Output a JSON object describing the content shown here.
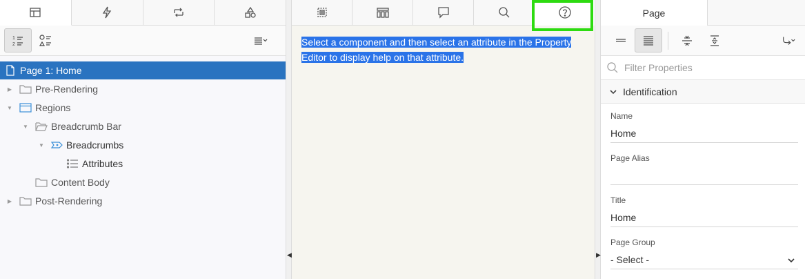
{
  "left": {
    "tabs": [
      {
        "icon": "rendering-tree-icon"
      },
      {
        "icon": "dynamic-actions-icon"
      },
      {
        "icon": "processing-icon"
      },
      {
        "icon": "shared-components-icon"
      }
    ],
    "toolbar": {
      "view_buttons": [
        {
          "icon": "numbered-list-icon",
          "pressed": true
        },
        {
          "icon": "grouped-list-icon",
          "pressed": false
        }
      ],
      "menu_icon": "menu-icon"
    },
    "tree": [
      {
        "label": "Page 1: Home",
        "icon": "page-icon",
        "toggle": "",
        "selected": true
      },
      {
        "label": "Pre-Rendering",
        "icon": "folder-icon",
        "toggle": "▶"
      },
      {
        "label": "Regions",
        "icon": "region-icon",
        "toggle": "▼"
      },
      {
        "label": "Breadcrumb Bar",
        "icon": "folder-open-icon",
        "toggle": "▼"
      },
      {
        "label": "Breadcrumbs",
        "icon": "breadcrumb-icon",
        "toggle": "▼"
      },
      {
        "label": "Attributes",
        "icon": "list-icon",
        "toggle": ""
      },
      {
        "label": "Content Body",
        "icon": "folder-icon",
        "toggle": ""
      },
      {
        "label": "Post-Rendering",
        "icon": "folder-icon",
        "toggle": "▶"
      }
    ]
  },
  "middle": {
    "tabs": [
      {
        "icon": "messages-icon"
      },
      {
        "icon": "page-search-icon"
      },
      {
        "icon": "comments-icon"
      },
      {
        "icon": "search-icon"
      },
      {
        "icon": "help-icon"
      }
    ],
    "help_text": "Select a component and then select an attribute in the Property Editor to display help on that attribute."
  },
  "right": {
    "tab_label": "Page",
    "toolbar": {
      "buttons": [
        "show-common-icon",
        "show-all-icon",
        "collapse-all-icon",
        "expand-all-icon",
        "go-to-group-icon"
      ]
    },
    "filter": {
      "placeholder": "Filter Properties"
    },
    "section": {
      "title": "Identification"
    },
    "properties": [
      {
        "label": "Name",
        "value": "Home"
      },
      {
        "label": "Page Alias",
        "value": ""
      },
      {
        "label": "Title",
        "value": "Home"
      },
      {
        "label": "Page Group",
        "value": "- Select -",
        "dropdown": true
      }
    ]
  },
  "colors": {
    "selection": "#2a73c0",
    "highlight_box": "#2ddb10",
    "help_text_highlight": "#2a73e8"
  }
}
